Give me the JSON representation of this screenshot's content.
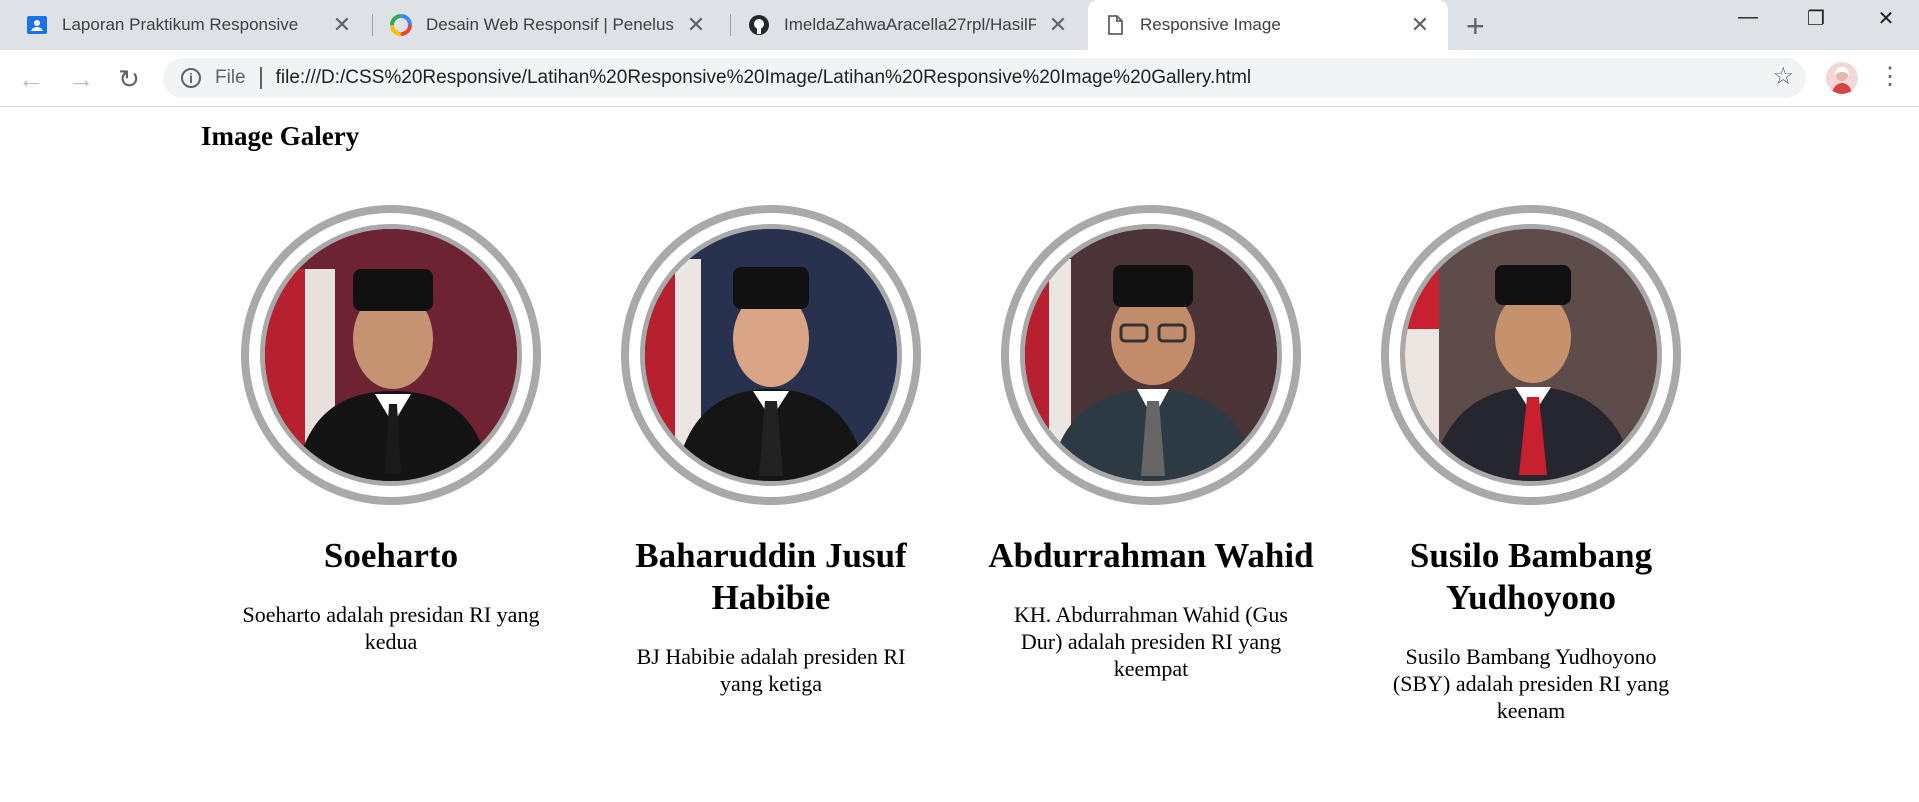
{
  "browser": {
    "tabs": [
      {
        "title": "Laporan Praktikum Responsive",
        "active": false
      },
      {
        "title": "Desain Web Responsif | Penelus",
        "active": false
      },
      {
        "title": "ImeldaZahwaAracella27rpl/HasilP",
        "active": false
      },
      {
        "title": "Responsive Image",
        "active": true
      }
    ],
    "address": {
      "scheme_label": "File",
      "url": "file:///D:/CSS%20Responsive/Latihan%20Responsive%20Image/Latihan%20Responsive%20Image%20Gallery.html"
    },
    "icons": {
      "back": "back-arrow-icon",
      "forward": "forward-arrow-icon",
      "reload": "reload-icon",
      "info": "info-icon",
      "bookmark": "star-icon",
      "menu": "kebab-menu-icon"
    }
  },
  "page": {
    "title": "Image Galery",
    "gallery": [
      {
        "name": "Soeharto",
        "desc": "Soeharto adalah presidan RI yang kedua",
        "bg": "#7a2a3a"
      },
      {
        "name": "Baharuddin Jusuf Habibie",
        "desc": "BJ Habibie adalah presiden RI yang ketiga",
        "bg": "#2a3450"
      },
      {
        "name": "Abdurrahman Wahid",
        "desc": "KH. Abdurrahman Wahid (Gus Dur) adalah presiden RI yang keempat",
        "bg": "#4a3438"
      },
      {
        "name": "Susilo Bambang Yudhoyono",
        "desc": "Susilo Bambang Yudhoyono (SBY) adalah presiden RI yang keenam",
        "bg": "#5a4a48"
      }
    ]
  },
  "colors": {
    "tabstrip": "#dee1e6",
    "ring": "#a9a9a9"
  }
}
